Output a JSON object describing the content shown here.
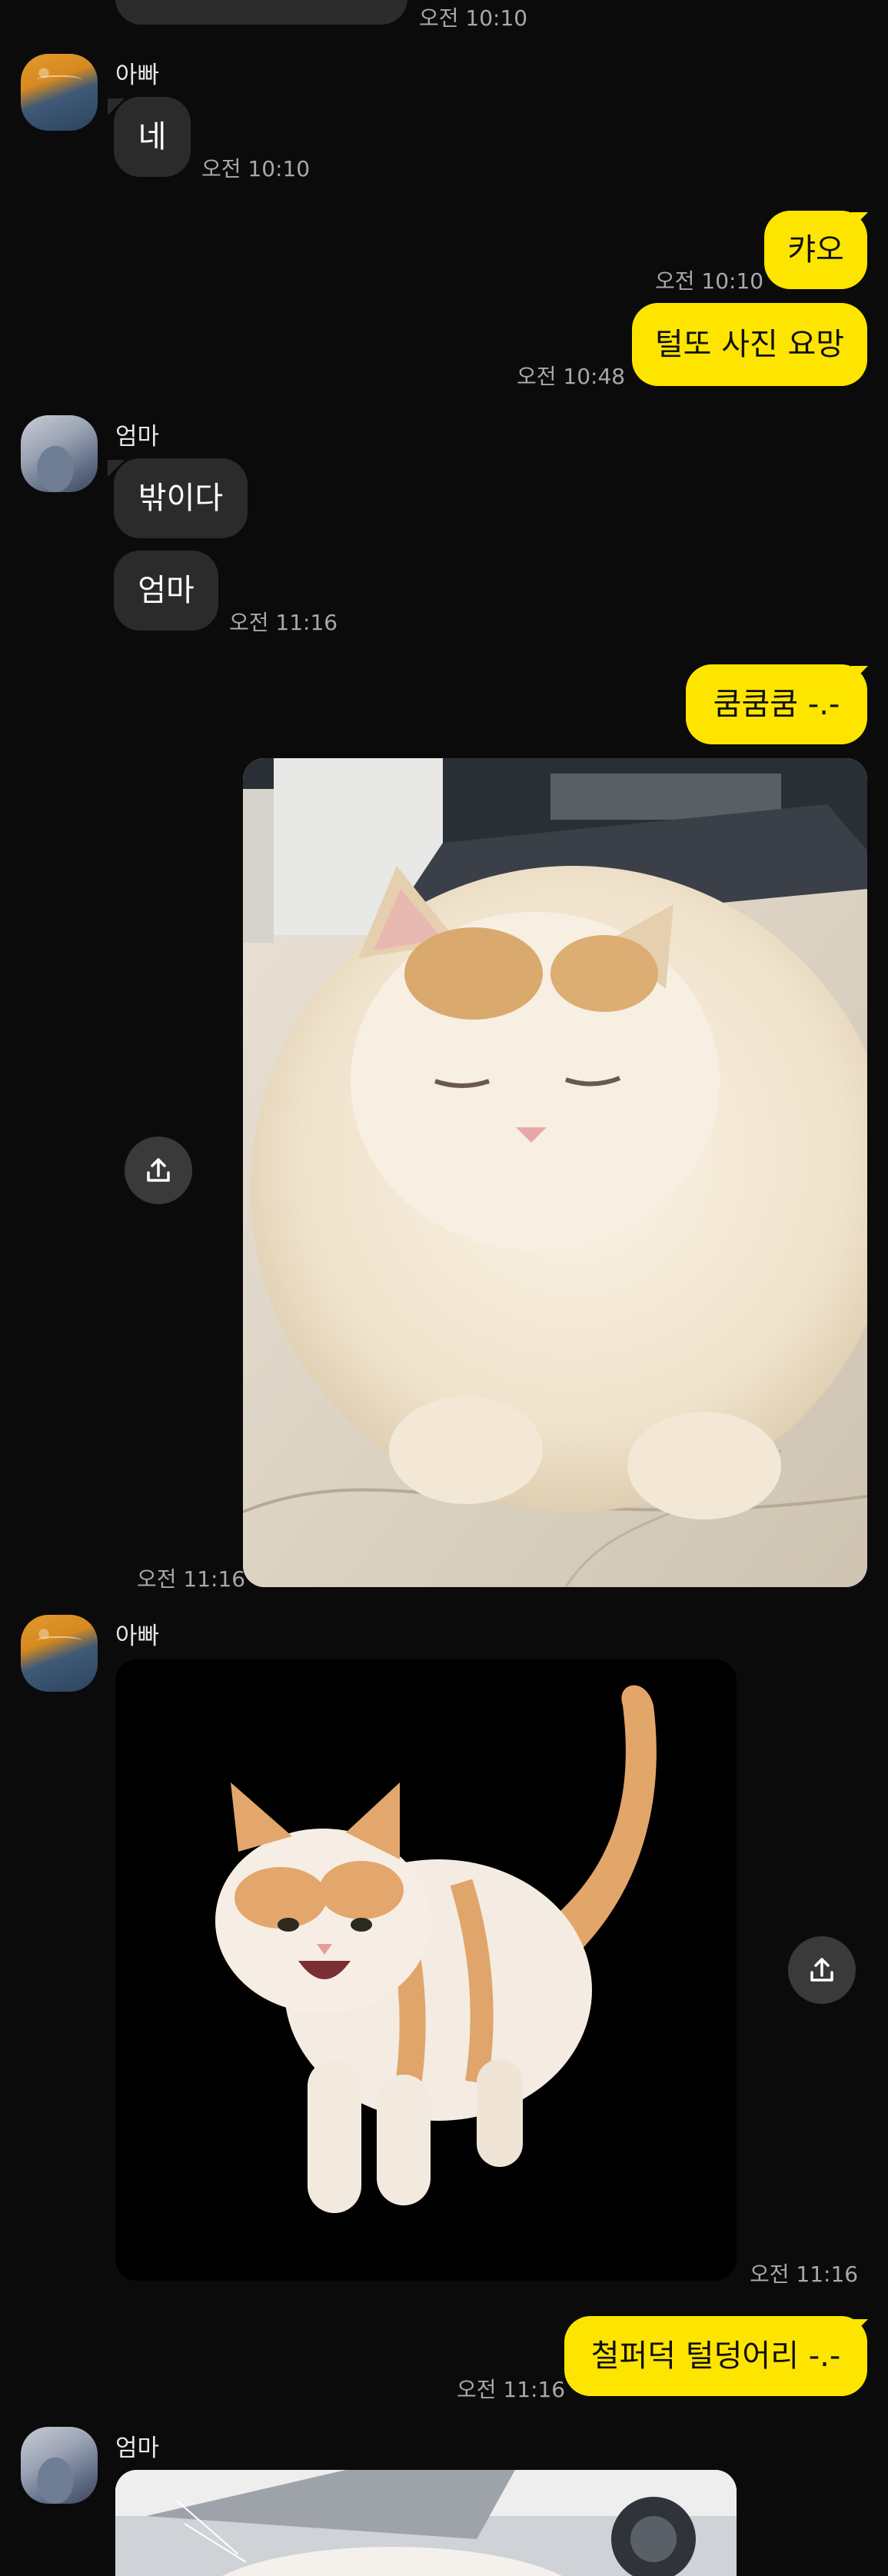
{
  "messages": {
    "m0": {
      "time": "오전 10:10"
    },
    "m1": {
      "sender": "아빠",
      "text": "네",
      "time": "오전 10:10"
    },
    "m2": {
      "text": "캬오",
      "time": "오전 10:10"
    },
    "m3": {
      "text": "털또 사진 요망",
      "time": "오전 10:48"
    },
    "m4": {
      "sender": "엄마",
      "text1": "밖이다",
      "text2": "엄마",
      "time": "오전 11:16"
    },
    "m5": {
      "text": "쿰쿰쿰 -.-"
    },
    "m6": {
      "time": "오전 11:16"
    },
    "m7": {
      "sender": "아빠",
      "time": "오전 11:16"
    },
    "m8": {
      "text": "철퍼덕 털덩어리 -.-",
      "time": "오전 11:16"
    },
    "m9": {
      "sender": "엄마"
    }
  },
  "icons": {
    "share": "share-icon",
    "avatar_dad": "avatar-dad",
    "avatar_mom": "avatar-mom"
  },
  "colors": {
    "background": "#0b0b0b",
    "incoming_bubble": "#2b2b2b",
    "outgoing_bubble": "#fee500"
  }
}
